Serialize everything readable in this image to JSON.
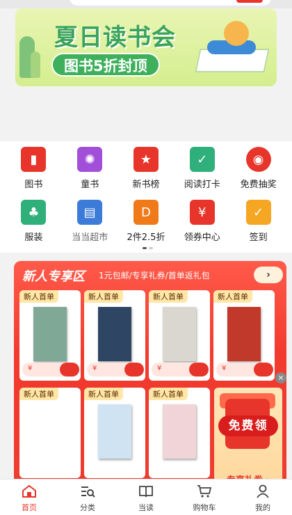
{
  "banner": {
    "title": "夏日读书会",
    "subtitle": "图书5折封顶"
  },
  "nav": {
    "items": [
      {
        "label": "图书",
        "icon": "book-icon",
        "color": "#e8352b"
      },
      {
        "label": "童书",
        "icon": "kids-book-icon",
        "color": "#a14fd8"
      },
      {
        "label": "新书榜",
        "icon": "ranking-icon",
        "color": "#e8352b"
      },
      {
        "label": "阅读打卡",
        "icon": "reading-checkin-icon",
        "color": "#2fb07a"
      },
      {
        "label": "免费抽奖",
        "icon": "lottery-icon",
        "color": "#e8352b"
      },
      {
        "label": "服装",
        "icon": "dress-icon",
        "color": "#2fb07a"
      },
      {
        "label": "当当超市",
        "icon": "basket-icon",
        "color": "#3d7bd9"
      },
      {
        "label": "2件2.5折",
        "icon": "disney-icon",
        "color": "#f07a1a"
      },
      {
        "label": "领券中心",
        "icon": "coupon-icon",
        "color": "#e8352b"
      },
      {
        "label": "签到",
        "icon": "calendar-icon",
        "color": "#f5a623"
      }
    ]
  },
  "zone": {
    "title": "新人专享区",
    "subtitle": "1元包邮/专享礼券/首单返礼包",
    "arrow": "›",
    "card_tag": "新人首单",
    "currency": "¥",
    "cards": [
      {
        "tag": "新人首单",
        "book_color": "#7fa896"
      },
      {
        "tag": "新人首单",
        "book_color": "#2e4663"
      },
      {
        "tag": "新人首单",
        "book_color": "#d9d7cf"
      },
      {
        "tag": "新人首单",
        "book_color": "#c0392b"
      },
      {
        "tag": "新人首单",
        "book_color": ""
      },
      {
        "tag": "新人首单",
        "book_color": "#cfe3f2"
      },
      {
        "tag": "新人首单",
        "book_color": "#f0d4d8"
      }
    ],
    "promo_free": "免费领",
    "promo_text": "专享礼券 ›"
  },
  "tabbar": {
    "items": [
      {
        "label": "首页",
        "icon": "home-icon",
        "active": true
      },
      {
        "label": "分类",
        "icon": "category-icon",
        "active": false
      },
      {
        "label": "当读",
        "icon": "read-icon",
        "active": false
      },
      {
        "label": "购物车",
        "icon": "cart-icon",
        "active": false
      },
      {
        "label": "我的",
        "icon": "profile-icon",
        "active": false
      }
    ]
  },
  "close_label": "×"
}
